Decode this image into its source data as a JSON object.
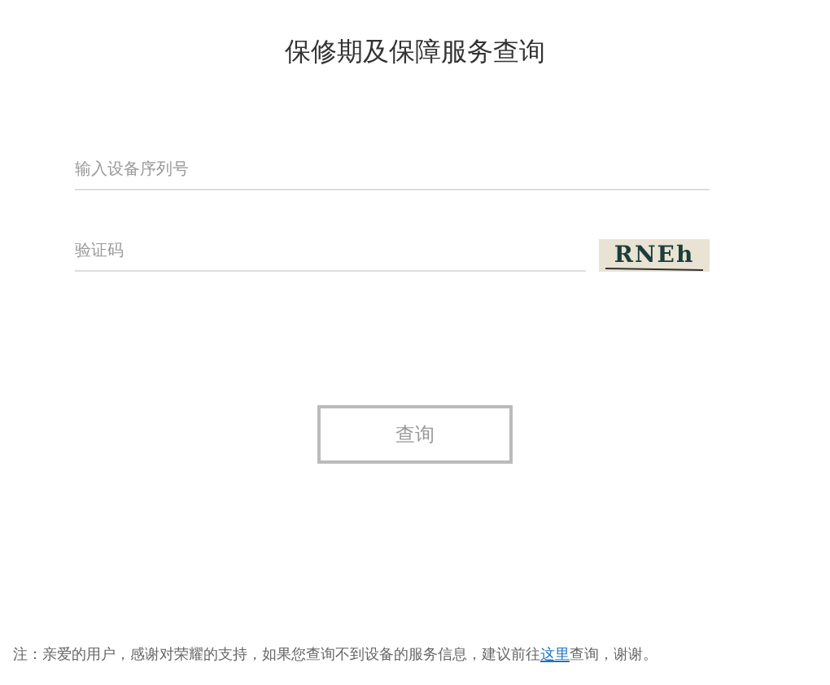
{
  "title": "保修期及保障服务查询",
  "serial_field": {
    "placeholder": "输入设备序列号"
  },
  "captcha_field": {
    "placeholder": "验证码"
  },
  "captcha_image": {
    "text": "RNEh"
  },
  "query_button": {
    "label": "查询"
  },
  "note": {
    "before": "注：亲爱的用户，感谢对荣耀的支持，如果您查询不到设备的服务信息，建议前往",
    "link": "这里",
    "after": "查询，谢谢。"
  }
}
